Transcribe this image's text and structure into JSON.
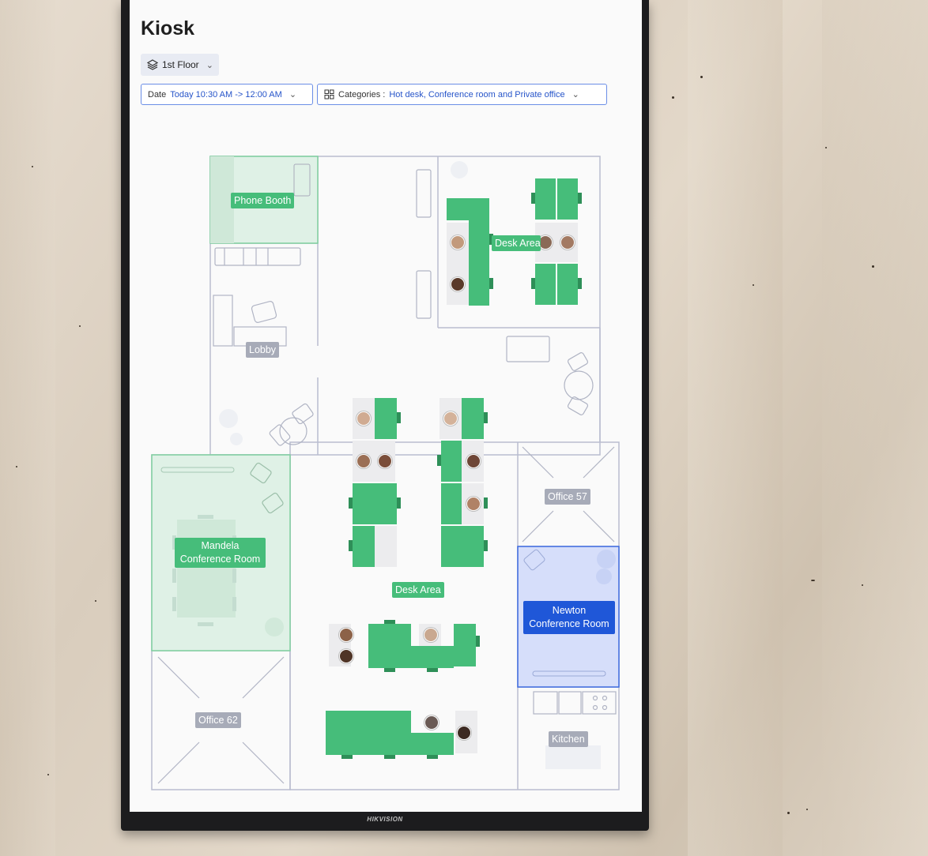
{
  "app": {
    "title": "Kiosk"
  },
  "floor_selector": {
    "label": "1st Floor",
    "icon": "layers-icon"
  },
  "filters": {
    "date": {
      "label": "Date",
      "value": "Today 10:30 AM -> 12:00 AM"
    },
    "categories": {
      "label": "Categories :",
      "value": "Hot desk, Conference room and Private office"
    }
  },
  "rooms": {
    "phone_booth": "Phone Booth",
    "desk_area_top": "Desk Area",
    "lobby": "Lobby",
    "office_57": "Office 57",
    "mandela": "Mandela Conference Room",
    "desk_area_center": "Desk Area",
    "newton": "Newton Conference Room",
    "office_62": "Office 62",
    "kitchen": "Kitchen"
  },
  "device": {
    "brand": "HIKVISION"
  },
  "colors": {
    "available": "#46bd7a",
    "available_area": "#dff1e6",
    "selected": "#1f57d8",
    "selected_area": "#d6defa",
    "unavailable": "#a7abb8",
    "wall": "#b9bdd0"
  }
}
